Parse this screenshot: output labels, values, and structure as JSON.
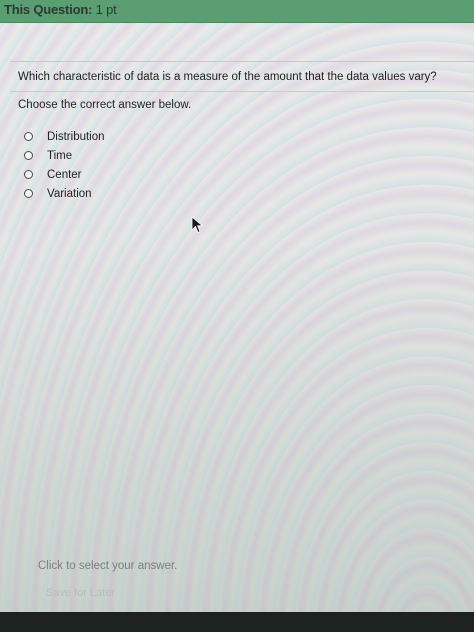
{
  "header": {
    "title": "This Question:",
    "points": "1 pt",
    "background_color": "#5a9e72"
  },
  "question": {
    "text": "Which characteristic of data is a measure of the amount that the data values vary?",
    "instruction": "Choose the correct answer below."
  },
  "options": [
    {
      "label": "Distribution",
      "selected": false
    },
    {
      "label": "Time",
      "selected": false
    },
    {
      "label": "Center",
      "selected": false
    },
    {
      "label": "Variation",
      "selected": false
    }
  ],
  "footer": {
    "hint": "Click to select your answer.",
    "save_label": "Save for Later"
  },
  "icons": {
    "cursor": "mouse-pointer-icon",
    "radio": "radio-button-icon"
  }
}
